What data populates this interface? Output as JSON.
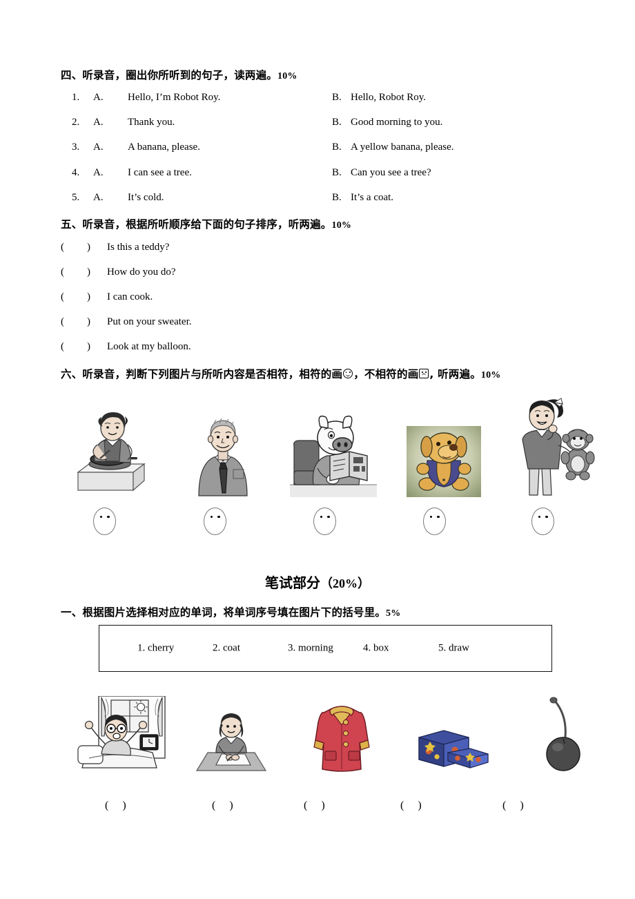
{
  "sections": [
    {
      "id": "sec4",
      "heading_text": "四、听录音，圈出你所听到的句子，读两遍。",
      "score": "10%",
      "items": [
        {
          "num": "1.",
          "a_label": "A.",
          "a_text": "Hello, I’m Robot Roy.",
          "b_label": "B.",
          "b_text": "Hello, Robot Roy."
        },
        {
          "num": "2.",
          "a_label": "A.",
          "a_text": "Thank you.",
          "b_label": "B.",
          "b_text": "Good morning to you."
        },
        {
          "num": "3.",
          "a_label": "A.",
          "a_text": "A banana, please.",
          "b_label": "B.",
          "b_text": "A yellow banana, please."
        },
        {
          "num": "4.",
          "a_label": "A.",
          "a_text": "I can see a tree.",
          "b_label": "B.",
          "b_text": "Can you see a tree?"
        },
        {
          "num": "5.",
          "a_label": "A.",
          "a_text": "It’s cold.",
          "b_label": "B.",
          "b_text": "It’s a coat."
        }
      ]
    },
    {
      "id": "sec5",
      "heading_text": "五、听录音，根据所听顺序给下面的句子排序，听两遍。",
      "score": "10%",
      "items": [
        {
          "paren_open": "(",
          "paren_close": ")",
          "sentence": "Is this a teddy?",
          "answer": ""
        },
        {
          "paren_open": "(",
          "paren_close": ")",
          "sentence": "How do you do?",
          "answer": ""
        },
        {
          "paren_open": "(",
          "paren_close": ")",
          "sentence": "I can cook.",
          "answer": ""
        },
        {
          "paren_open": "(",
          "paren_close": ")",
          "sentence": "Put on your sweater.",
          "answer": ""
        },
        {
          "paren_open": "(",
          "paren_close": ")",
          "sentence": "Look at my balloon.",
          "answer": ""
        }
      ]
    },
    {
      "id": "sec6",
      "heading_part1": "六、听录音，判断下列图片与所听内容是否相符，相符的画",
      "heading_part2": "，不相符的画",
      "heading_part3": ", 听两遍。",
      "score": "10%",
      "pictures": [
        {
          "name": "woman-cooking-on-stove",
          "alt": "woman cooking in a pan on a stove"
        },
        {
          "name": "man-in-shirt-and-tie",
          "alt": "man wearing shirt and necktie"
        },
        {
          "name": "pig-reading-book",
          "alt": "cartoon pig reading a book in an armchair"
        },
        {
          "name": "yellow-toy-dog",
          "alt": "yellow stuffed toy dog in blue overalls"
        },
        {
          "name": "girl-holding-monkey-toy",
          "alt": "girl with ponytail holding a toy monkey"
        }
      ],
      "answer_faces": [
        "",
        "",
        "",
        "",
        ""
      ]
    }
  ],
  "written_part": {
    "title_text": "笔试部分",
    "title_score": "（20%）",
    "sections": [
      {
        "id": "w1",
        "heading_text": "一、根据图片选择相对应的单词，将单词序号填在图片下的括号里。",
        "score": "5%",
        "word_bank": [
          "1. cherry",
          "2. coat",
          "3. morning",
          "4. box",
          "5. draw"
        ],
        "pictures": [
          {
            "name": "child-waking-up-in-morning",
            "alt": "child stretching awake in bed by a sunny window"
          },
          {
            "name": "girl-drawing-at-desk",
            "alt": "girl drawing on paper at a desk"
          },
          {
            "name": "red-coat",
            "alt": "red coat with yellow collar and cuffs"
          },
          {
            "name": "decorated-box",
            "alt": "blue decorated box with its lid beside it"
          },
          {
            "name": "cherry",
            "alt": "dark cherry with a long stem"
          }
        ],
        "answer_parens": [
          "(     )",
          "(     )",
          "(     )",
          "(     )",
          "(     )"
        ]
      }
    ]
  },
  "colors": {
    "text": "#000000",
    "page_background": "#ffffff",
    "box_border": "#111111",
    "face_outline": "#7a7a7a"
  }
}
